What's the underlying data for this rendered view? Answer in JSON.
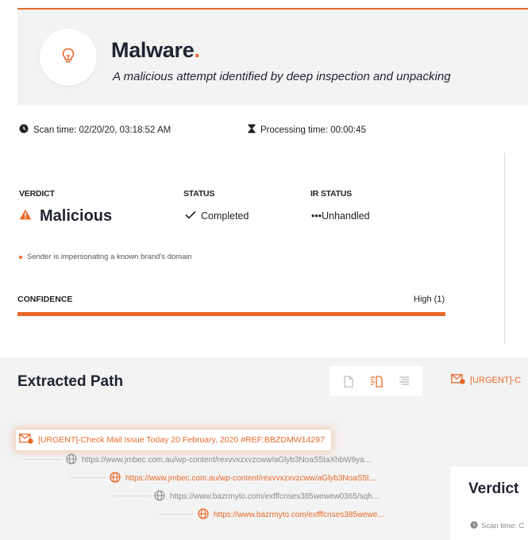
{
  "header": {
    "title": "Malware",
    "title_dot": ".",
    "subtitle": "A malicious attempt identified by deep inspection and unpacking",
    "icon": "lightbulb-icon"
  },
  "meta": {
    "scan_time": "Scan time: 02/20/20, 03:18:52 AM",
    "processing_time": "Processing time: 00:00:45"
  },
  "summary": {
    "verdict_label": "VERDICT",
    "verdict_value": "Malicious",
    "status_label": "STATUS",
    "status_value": "Completed",
    "ir_status_label": "IR STATUS",
    "ir_status_value": "•••Unhandled",
    "reason": "Sender is impersonating a known brand's domain"
  },
  "confidence": {
    "label": "CONFIDENCE",
    "value": "High (1)",
    "level": 1.0
  },
  "extracted_path": {
    "title": "Extracted Path",
    "tab_label": "[URGENT]-C",
    "root": "[URGENT]-Check Mail Issue Today 20 February, 2020 #REF:BBZDMW14297",
    "items": [
      {
        "text": "https://www.jmbec.com.au/wp-content/rexvvxzxvzcww/aGlyb3NoaS5taXhbW9ya...",
        "state": "gray"
      },
      {
        "text": "https://www.jmbec.com.au/wp-content/rexvvxzxvzcww/aGlyb3NoaS5t...",
        "state": "orange"
      },
      {
        "text": "https://www.bazrmyto.com/exfffcnses385wewew0365/sqh...",
        "state": "gray"
      },
      {
        "text": "https://www.bazrmyto.com/exfffcnses385wewe...",
        "state": "orange"
      }
    ]
  },
  "side_panel": {
    "title": "Verdict",
    "scan_label": "Scan time: C"
  },
  "colors": {
    "accent": "#e8692a",
    "title": "#1f2330",
    "panel": "#f3f3f3"
  }
}
